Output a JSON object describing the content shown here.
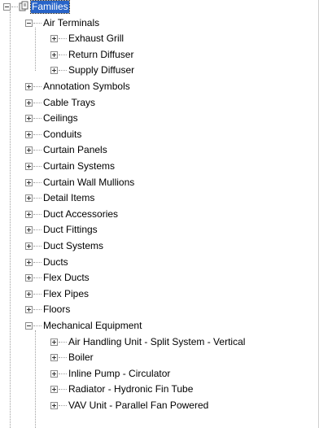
{
  "tree": {
    "root": {
      "label": "Families",
      "icon": "family-folder-icon",
      "selected": true
    },
    "items": [
      {
        "label": "Air Terminals",
        "expanded": true,
        "children": [
          {
            "label": "Exhaust Grill",
            "expanded": false
          },
          {
            "label": "Return Diffuser",
            "expanded": false
          },
          {
            "label": "Supply Diffuser",
            "expanded": false
          }
        ]
      },
      {
        "label": "Annotation Symbols",
        "expanded": false
      },
      {
        "label": "Cable Trays",
        "expanded": false
      },
      {
        "label": "Ceilings",
        "expanded": false
      },
      {
        "label": "Conduits",
        "expanded": false
      },
      {
        "label": "Curtain Panels",
        "expanded": false
      },
      {
        "label": "Curtain Systems",
        "expanded": false
      },
      {
        "label": "Curtain Wall Mullions",
        "expanded": false
      },
      {
        "label": "Detail Items",
        "expanded": false
      },
      {
        "label": "Duct Accessories",
        "expanded": false
      },
      {
        "label": "Duct Fittings",
        "expanded": false
      },
      {
        "label": "Duct Systems",
        "expanded": false
      },
      {
        "label": "Ducts",
        "expanded": false
      },
      {
        "label": "Flex Ducts",
        "expanded": false
      },
      {
        "label": "Flex Pipes",
        "expanded": false
      },
      {
        "label": "Floors",
        "expanded": false
      },
      {
        "label": "Mechanical Equipment",
        "expanded": true,
        "children": [
          {
            "label": "Air Handling Unit - Split System - Vertical",
            "expanded": false
          },
          {
            "label": "Boiler",
            "expanded": false
          },
          {
            "label": "Inline Pump - Circulator",
            "expanded": false
          },
          {
            "label": "Radiator - Hydronic Fin Tube",
            "expanded": false
          },
          {
            "label": "VAV Unit - Parallel Fan Powered",
            "expanded": false
          }
        ]
      }
    ]
  },
  "colors": {
    "selection": "#2864c8",
    "connector": "#a0a0a0",
    "expander_border": "#8c8c8c"
  }
}
